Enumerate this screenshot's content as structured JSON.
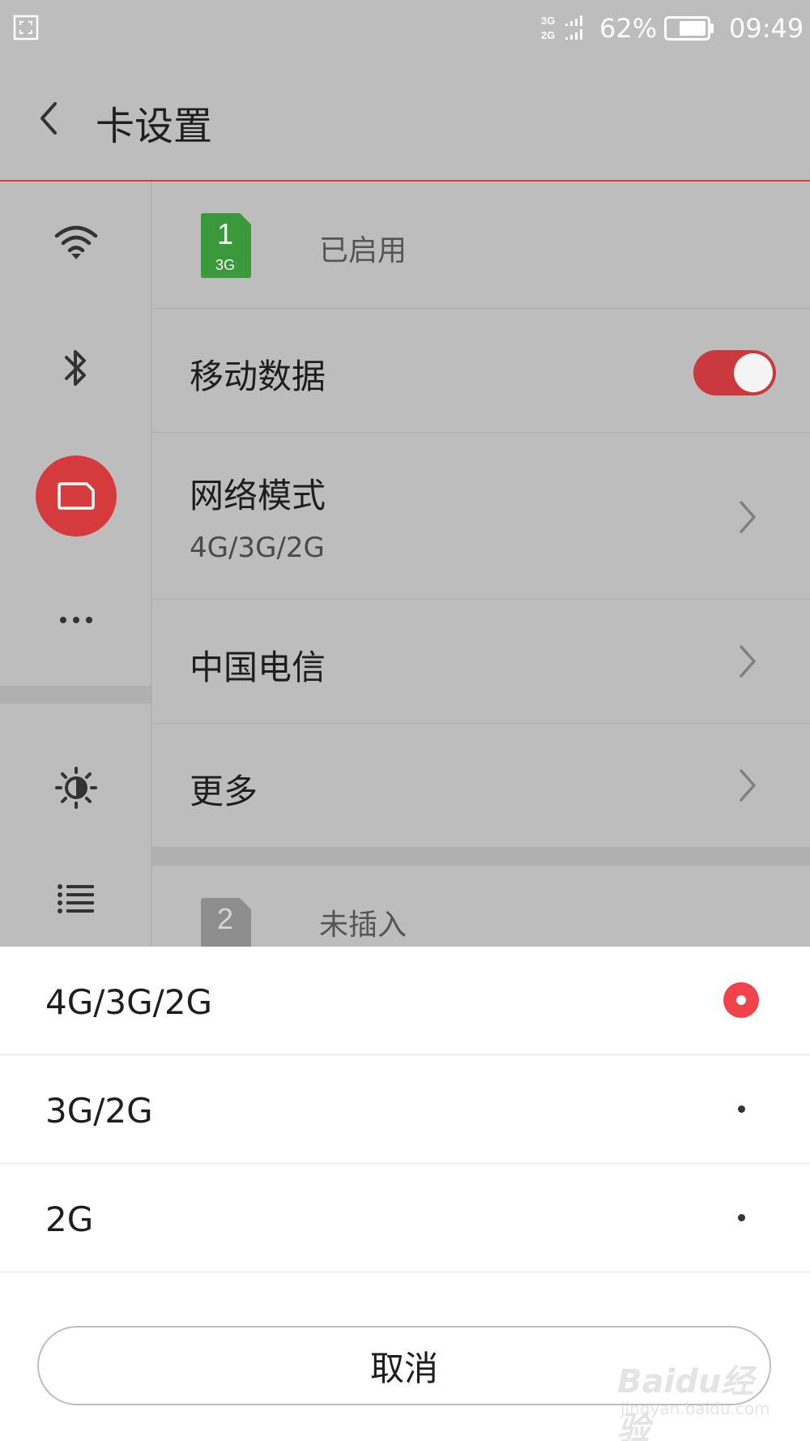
{
  "status_bar": {
    "network_label_top": "3G",
    "network_label_bottom": "2G",
    "battery": "62%",
    "time": "09:49"
  },
  "header": {
    "title": "卡设置"
  },
  "sidebar": {
    "items": [
      {
        "icon": "wifi-icon"
      },
      {
        "icon": "bluetooth-icon"
      },
      {
        "icon": "sim-card-icon",
        "active": true
      },
      {
        "icon": "more-icon"
      },
      {
        "icon": "brightness-icon"
      },
      {
        "icon": "list-icon"
      }
    ]
  },
  "sim1": {
    "number": "1",
    "network": "3G",
    "status": "已启用",
    "mobile_data_label": "移动数据",
    "mobile_data_on": true,
    "network_mode_label": "网络模式",
    "network_mode_value": "4G/3G/2G",
    "carrier": "中国电信",
    "more": "更多"
  },
  "sim2": {
    "number": "2",
    "status": "未插入"
  },
  "sheet": {
    "options": [
      {
        "label": "4G/3G/2G",
        "selected": true
      },
      {
        "label": "3G/2G",
        "selected": false
      },
      {
        "label": "2G",
        "selected": false
      }
    ],
    "cancel": "取消"
  },
  "watermark": {
    "text": "Baidu经验",
    "sub": "jingyan.baidu.com"
  },
  "colors": {
    "accent": "#d53a3d",
    "radio_selected": "#f0434b",
    "sim_active": "#3a9a3b",
    "sim_inactive": "#8e8e8e",
    "dim_background": "#bdbdbd"
  }
}
